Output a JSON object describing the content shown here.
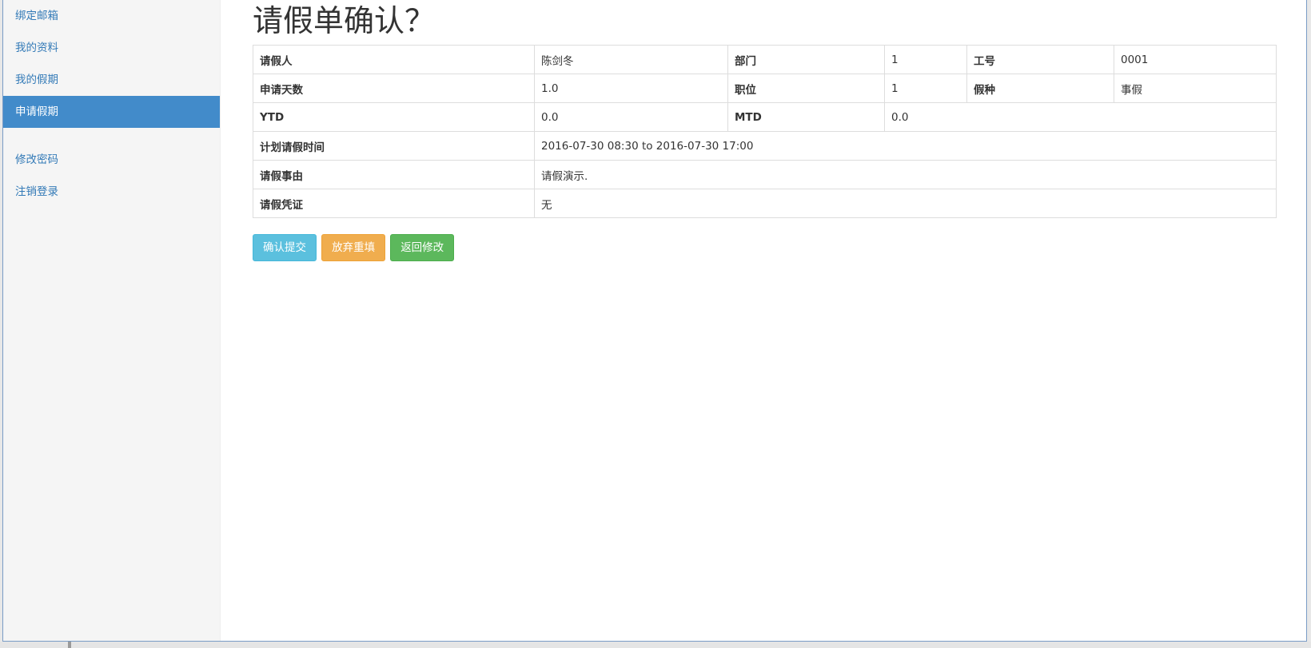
{
  "sidebar": {
    "group1": [
      {
        "label": "绑定邮箱"
      },
      {
        "label": "我的资料"
      },
      {
        "label": "我的假期"
      },
      {
        "label": "申请假期",
        "active": true
      }
    ],
    "group2": [
      {
        "label": "修改密码"
      },
      {
        "label": "注销登录"
      }
    ]
  },
  "main": {
    "title": "请假单确认？",
    "table": {
      "applicant_label": "请假人",
      "applicant_value": "陈剑冬",
      "department_label": "部门",
      "department_value": "1",
      "employee_id_label": "工号",
      "employee_id_value": "0001",
      "days_label": "申请天数",
      "days_value": "1.0",
      "position_label": "职位",
      "position_value": "1",
      "leave_type_label": "假种",
      "leave_type_value": "事假",
      "ytd_label": "YTD",
      "ytd_value": "0.0",
      "mtd_label": "MTD",
      "mtd_value": "0.0",
      "planned_time_label": "计划请假时间",
      "planned_time_value": "2016-07-30 08:30 to 2016-07-30 17:00",
      "reason_label": "请假事由",
      "reason_value": "请假演示.",
      "proof_label": "请假凭证",
      "proof_value": "无"
    },
    "buttons": {
      "confirm": "确认提交",
      "discard": "放弃重填",
      "back": "返回修改"
    }
  },
  "colors": {
    "sidebar_active": "#428bca",
    "link": "#337ab7",
    "btn_info": "#5bc0de",
    "btn_warning": "#f0ad4e",
    "btn_success": "#5cb85c"
  }
}
